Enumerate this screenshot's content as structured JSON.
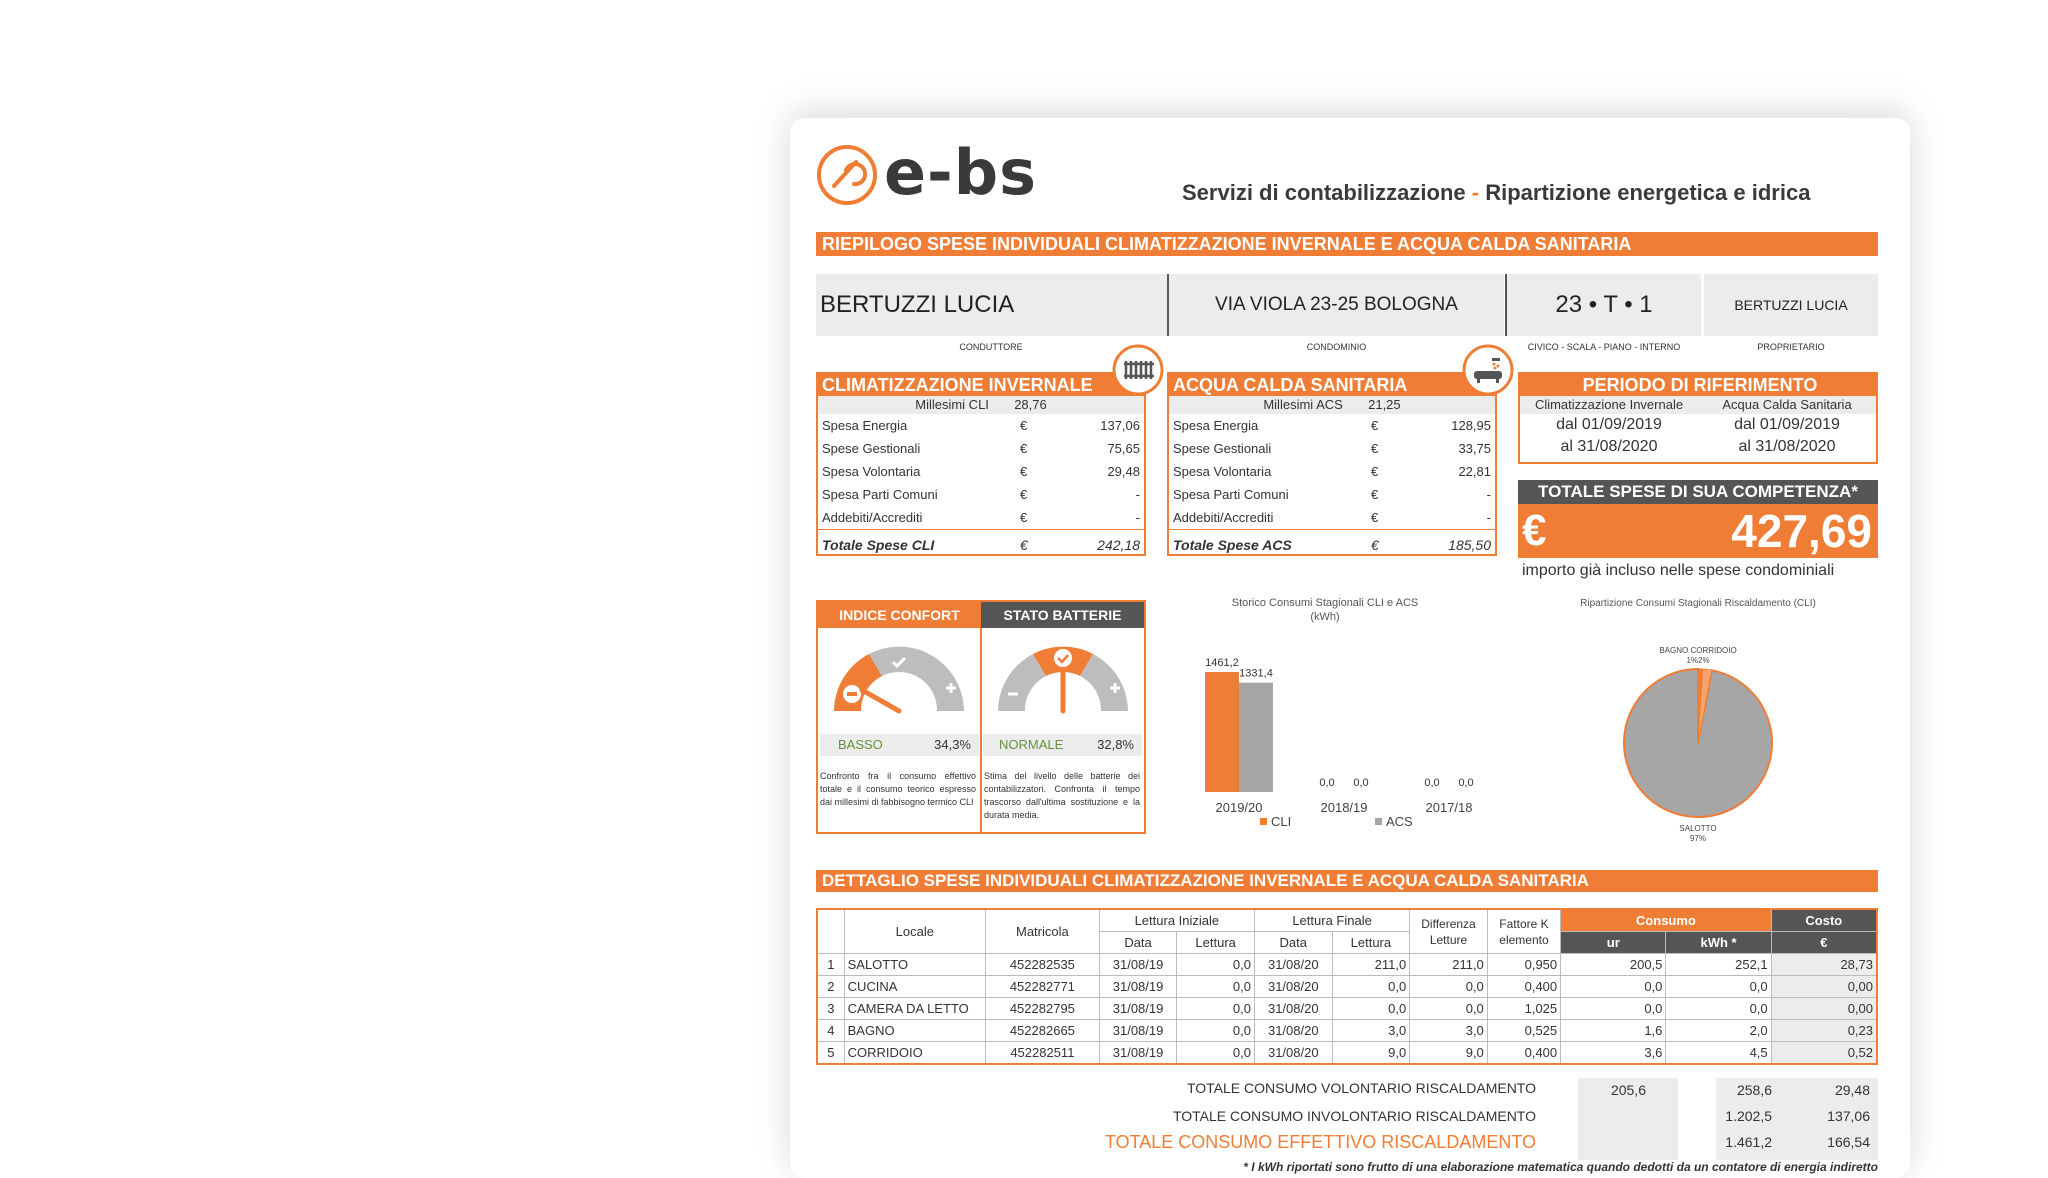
{
  "header": {
    "logo": "e-bs",
    "tagline_a": "Servizi di contabilizzazione",
    "tagline_sep": "-",
    "tagline_b": "Ripartizione energetica e idrica"
  },
  "title_bar": "RIEPILOGO SPESE INDIVIDUALI CLIMATIZZAZIONE INVERNALE E ACQUA CALDA SANITARIA",
  "info": {
    "conduttore": "BERTUZZI LUCIA",
    "condominio": "VIA VIOLA 23-25 BOLOGNA",
    "civico": "23 • T • 1",
    "proprietario": "BERTUZZI LUCIA",
    "cap_conduttore": "CONDUTTORE",
    "cap_condominio": "CONDOMINIO",
    "cap_civico": "CIVICO - SCALA - PIANO - INTERNO",
    "cap_proprietario": "PROPRIETARIO"
  },
  "cli": {
    "title": "CLIMATIZZAZIONE INVERNALE",
    "millesimi_label": "Millesimi CLI",
    "millesimi": "28,76",
    "rows": [
      {
        "label": "Spesa Energia",
        "cur": "€",
        "value": "137,06"
      },
      {
        "label": "Spese Gestionali",
        "cur": "€",
        "value": "75,65"
      },
      {
        "label": "Spesa Volontaria",
        "cur": "€",
        "value": "29,48"
      },
      {
        "label": "Spesa Parti Comuni",
        "cur": "€",
        "value": "-"
      },
      {
        "label": "Addebiti/Accrediti",
        "cur": "€",
        "value": "-"
      }
    ],
    "total_label": "Totale Spese CLI",
    "total_cur": "€",
    "total": "242,18"
  },
  "acs": {
    "title": "ACQUA CALDA SANITARIA",
    "millesimi_label": "Millesimi ACS",
    "millesimi": "21,25",
    "rows": [
      {
        "label": "Spesa Energia",
        "cur": "€",
        "value": "128,95"
      },
      {
        "label": "Spese Gestionali",
        "cur": "€",
        "value": "33,75"
      },
      {
        "label": "Spesa Volontaria",
        "cur": "€",
        "value": "22,81"
      },
      {
        "label": "Spesa Parti Comuni",
        "cur": "€",
        "value": "-"
      },
      {
        "label": "Addebiti/Accrediti",
        "cur": "€",
        "value": "-"
      }
    ],
    "total_label": "Totale Spese ACS",
    "total_cur": "€",
    "total": "185,50"
  },
  "periodo": {
    "title": "PERIODO DI RIFERIMENTO",
    "col1": "Climatizzazione Invernale",
    "col2": "Acqua Calda Sanitaria",
    "dal1": "dal 01/09/2019",
    "al1": "al 31/08/2020",
    "dal2": "dal 01/09/2019",
    "al2": "al 31/08/2020"
  },
  "totale": {
    "title": "TOTALE SPESE DI SUA COMPETENZA*",
    "currency": "€",
    "amount": "427,69",
    "note": "importo già incluso nelle spese condominiali"
  },
  "confort": {
    "title": "INDICE CONFORT",
    "level": "BASSO",
    "pct": "34,3%",
    "desc": "Confronto fra il consumo effettivo totale e il consumo teorico espresso dai millesimi di fabbisogno termico CLI"
  },
  "batterie": {
    "title": "STATO BATTERIE",
    "level": "NORMALE",
    "pct": "32,8%",
    "desc": "Stima del livello delle batterie dei contabilizzatori. Confronta il tempo trascorso dall'ultima sostituzione e la durata media."
  },
  "chart_data": [
    {
      "type": "bar",
      "title": "Storico Consumi Stagionali CLI e ACS",
      "subtitle": "(kWh)",
      "categories": [
        "2019/20",
        "2018/19",
        "2017/18"
      ],
      "series": [
        {
          "name": "CLI",
          "values": [
            1461.2,
            0.0,
            0.0
          ],
          "labels": [
            "1461,2",
            "0,0",
            "0,0"
          ],
          "color": "#ef7d35"
        },
        {
          "name": "ACS",
          "values": [
            1331.4,
            0.0,
            0.0
          ],
          "labels": [
            "1331,4",
            "0,0",
            "0,0"
          ],
          "color": "#a6a6a6"
        }
      ],
      "legend": "bottom"
    },
    {
      "type": "pie",
      "title": "Ripartizione Consumi Stagionali Riscaldamento (CLI)",
      "slices": [
        {
          "name": "SALOTTO",
          "value": 97,
          "label": "97%",
          "color": "#a6a6a6"
        },
        {
          "name": "CORRIDOIO",
          "value": 1,
          "label": "1%",
          "color": "#ef7d35"
        },
        {
          "name": "BAGNO",
          "value": 2,
          "label": "2%",
          "color": "#f4a46f"
        }
      ],
      "top_labels": "BAGNO CORRIDOIO",
      "top_pct": "1%2%"
    }
  ],
  "detail_bar": "DETTAGLIO SPESE INDIVIDUALI CLIMATIZZAZIONE INVERNALE E ACQUA CALDA SANITARIA",
  "table": {
    "h_locale": "Locale",
    "h_matricola": "Matricola",
    "h_lett_iniz": "Lettura Iniziale",
    "h_lett_fin": "Lettura Finale",
    "h_diff": "Differenza",
    "h_diff2": "Letture",
    "h_fatt": "Fattore K",
    "h_fatt2": "elemento",
    "h_consumo": "Consumo",
    "h_costo": "Costo",
    "h_data": "Data",
    "h_lettura": "Lettura",
    "h_ur": "ur",
    "h_kwh": "kWh *",
    "h_eur": "€",
    "rows": [
      {
        "n": "1",
        "locale": "SALOTTO",
        "matricola": "452282535",
        "d1": "31/08/19",
        "l1": "0,0",
        "d2": "31/08/20",
        "l2": "211,0",
        "diff": "211,0",
        "k": "0,950",
        "ur": "200,5",
        "kwh": "252,1",
        "eur": "28,73"
      },
      {
        "n": "2",
        "locale": "CUCINA",
        "matricola": "452282771",
        "d1": "31/08/19",
        "l1": "0,0",
        "d2": "31/08/20",
        "l2": "0,0",
        "diff": "0,0",
        "k": "0,400",
        "ur": "0,0",
        "kwh": "0,0",
        "eur": "0,00"
      },
      {
        "n": "3",
        "locale": "CAMERA DA LETTO",
        "matricola": "452282795",
        "d1": "31/08/19",
        "l1": "0,0",
        "d2": "31/08/20",
        "l2": "0,0",
        "diff": "0,0",
        "k": "1,025",
        "ur": "0,0",
        "kwh": "0,0",
        "eur": "0,00"
      },
      {
        "n": "4",
        "locale": "BAGNO",
        "matricola": "452282665",
        "d1": "31/08/19",
        "l1": "0,0",
        "d2": "31/08/20",
        "l2": "3,0",
        "diff": "3,0",
        "k": "0,525",
        "ur": "1,6",
        "kwh": "2,0",
        "eur": "0,23"
      },
      {
        "n": "5",
        "locale": "CORRIDOIO",
        "matricola": "452282511",
        "d1": "31/08/19",
        "l1": "0,0",
        "d2": "31/08/20",
        "l2": "9,0",
        "diff": "9,0",
        "k": "0,400",
        "ur": "3,6",
        "kwh": "4,5",
        "eur": "0,52"
      }
    ],
    "tot_vol_label": "TOTALE CONSUMO VOLONTARIO RISCALDAMENTO",
    "tot_vol_ur": "205,6",
    "tot_vol_kwh": "258,6",
    "tot_vol_eur": "29,48",
    "tot_invol_label": "TOTALE CONSUMO INVOLONTARIO RISCALDAMENTO",
    "tot_invol_kwh": "1.202,5",
    "tot_invol_eur": "137,06",
    "tot_eff_label": "TOTALE CONSUMO EFFETTIVO RISCALDAMENTO",
    "tot_eff_kwh": "1.461,2",
    "tot_eff_eur": "166,54",
    "footnote": "* I kWh riportati sono frutto di una elaborazione matematica quando dedotti da un contatore di energia indiretto"
  }
}
